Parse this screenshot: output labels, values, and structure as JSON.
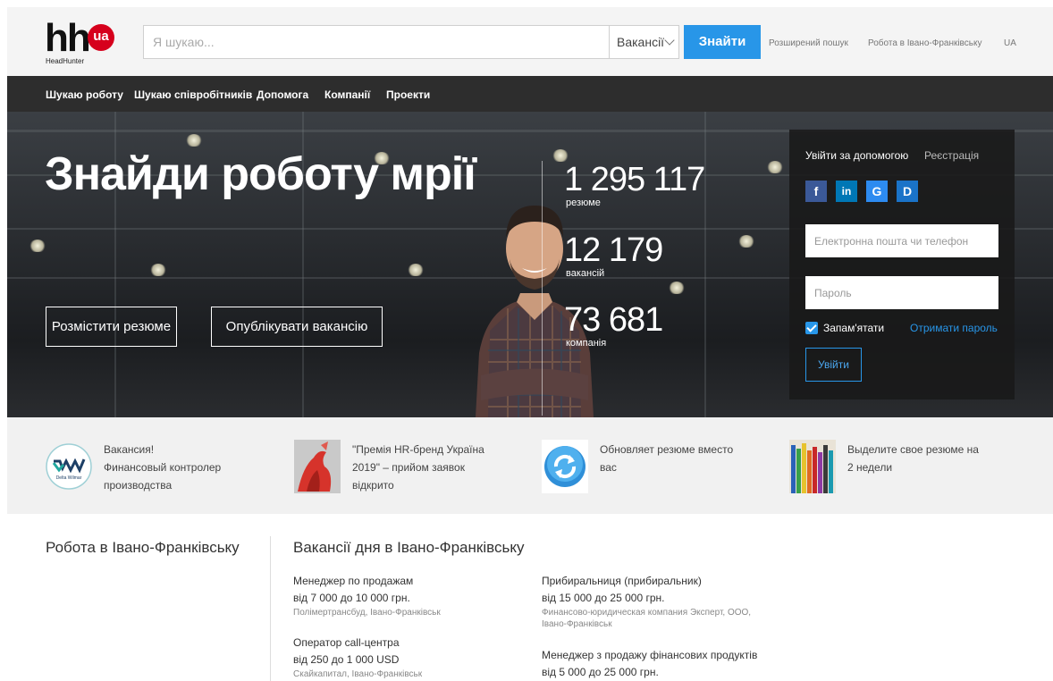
{
  "header": {
    "logo_text": "hh",
    "logo_badge": "ua",
    "logo_sub": "HeadHunter",
    "search_placeholder": "Я шукаю...",
    "search_type": "Вакансії",
    "search_button": "Знайти",
    "links": [
      "Розширений пошук",
      "Робота в Івано-Франківську",
      "UA"
    ]
  },
  "nav": {
    "items": [
      "Шукаю роботу",
      "Шукаю співробітників",
      "Допомога",
      "Компанії",
      "Проекти"
    ]
  },
  "hero": {
    "title": "Знайди роботу мрії",
    "buttons": [
      "Розмістити резюме",
      "Опублікувати вакансію"
    ],
    "stats": [
      {
        "value": "1 295 117",
        "label": "резюме"
      },
      {
        "value": "12 179",
        "label": "вакансій"
      },
      {
        "value": "73 681",
        "label": "компанія"
      }
    ]
  },
  "login": {
    "title": "Увійти за допомогою",
    "register": "Реєстрація",
    "social": [
      "f",
      "in",
      "G",
      "D"
    ],
    "email_placeholder": "Електронна пошта чи телефон",
    "password_placeholder": "Пароль",
    "remember": "Запам'ятати",
    "forgot": "Отримати пароль",
    "submit": "Увійти",
    "colors": {
      "facebook": "#3b5998",
      "linkedin": "#0077b5",
      "google": "#2d8bf0",
      "d": "#1a73c8"
    }
  },
  "promos": [
    {
      "lines": [
        "Вакансия!",
        "Финансовый контролер",
        "производства"
      ],
      "image_text": "Delta Wilmar",
      "icon": "delta-wilmar-logo"
    },
    {
      "lines": [
        "\"Премія HR-бренд Україна",
        "2019\" – прийом заявок",
        "відкрито"
      ],
      "icon": "hr-brand-image"
    },
    {
      "lines": [
        "Обновляет резюме вместо",
        "вас"
      ],
      "icon": "refresh-icon"
    },
    {
      "lines": [
        "Выделите свое резюме на",
        "2 недели"
      ],
      "icon": "pencils-image"
    }
  ],
  "bottom": {
    "city_title": "Робота в Івано-Франківську",
    "day_title": "Вакансії дня в Івано-Франківську",
    "jobs_left": [
      {
        "title": "Менеджер по продажам",
        "salary": "від 7 000 до 10 000 грн.",
        "company": "Полімертрансбуд, Івано-Франківськ"
      },
      {
        "title": "Оператор call-центра",
        "salary": "від 250 до 1 000 USD",
        "company": "Скайкапитал, Івано-Франківськ"
      }
    ],
    "jobs_right": [
      {
        "title": "Прибиральниця (прибиральник)",
        "salary": "від 15 000 до 25 000 грн.",
        "company": "Финансово-юридическая компания Эксперт, ООО, Івано-Франківськ"
      },
      {
        "title": "Менеджер з продажу фінансових продуктів",
        "salary": "від 5 000 до 25 000 грн.",
        "company": ""
      }
    ]
  }
}
